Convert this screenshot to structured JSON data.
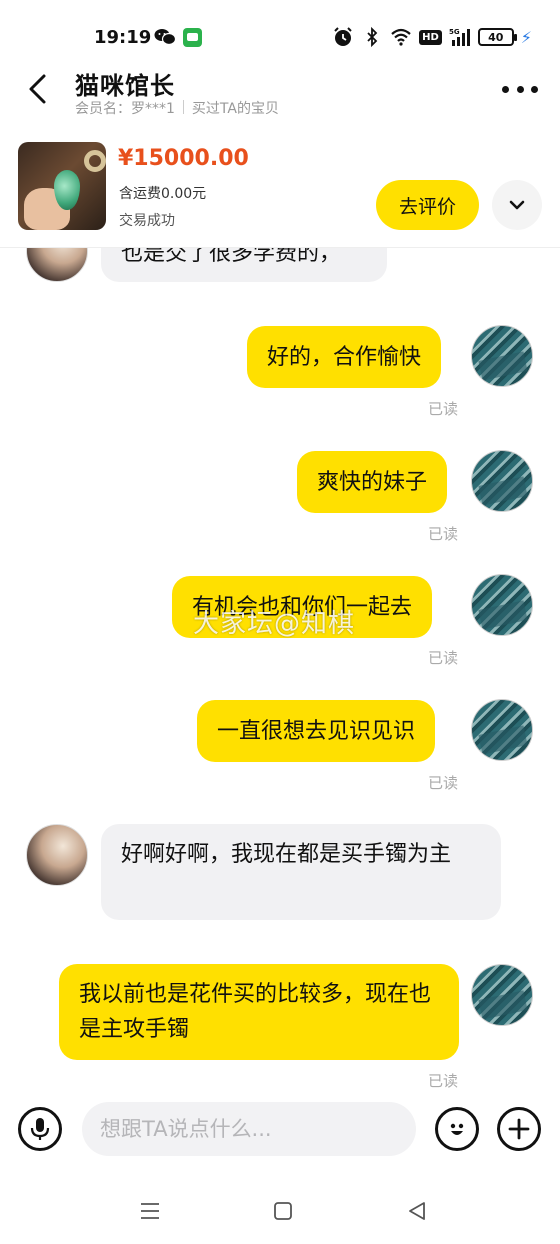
{
  "status_bar": {
    "time": "19:19",
    "network": "HD",
    "signal": "5G",
    "battery": "40",
    "icons": [
      "wechat-icon",
      "message-icon",
      "alarm-icon",
      "bluetooth-icon",
      "wifi-icon",
      "hd-icon",
      "signal-icon",
      "battery-icon",
      "charging-icon"
    ]
  },
  "header": {
    "title": "猫咪馆长",
    "member_label": "会员名：罗***1",
    "purchased_label": "买过TA的宝贝"
  },
  "product": {
    "price": "¥15000.00",
    "shipping": "含运费0.00元",
    "status": "交易成功",
    "review_button": "去评价"
  },
  "messages": [
    {
      "sender": "them",
      "text": "也是交了很多学费的，"
    },
    {
      "sender": "me",
      "text": "好的，合作愉快",
      "status": "已读"
    },
    {
      "sender": "me",
      "text": "爽快的妹子",
      "status": "已读"
    },
    {
      "sender": "me",
      "text": "有机会也和你们一起去",
      "status": "已读"
    },
    {
      "sender": "me",
      "text": "一直很想去见识见识",
      "status": "已读"
    },
    {
      "sender": "them",
      "text": "好啊好啊，我现在都是买手镯为主"
    },
    {
      "sender": "me",
      "text": "我以前也是花件买的比较多，现在也是主攻手镯",
      "status": "已读"
    }
  ],
  "watermark": "大家坛@知棋",
  "input": {
    "placeholder": "想跟TA说点什么..."
  },
  "colors": {
    "accent": "#ffe000",
    "price": "#e8501c",
    "bubble_other": "#f1f1f3",
    "read_status": "#aaaaaa"
  }
}
